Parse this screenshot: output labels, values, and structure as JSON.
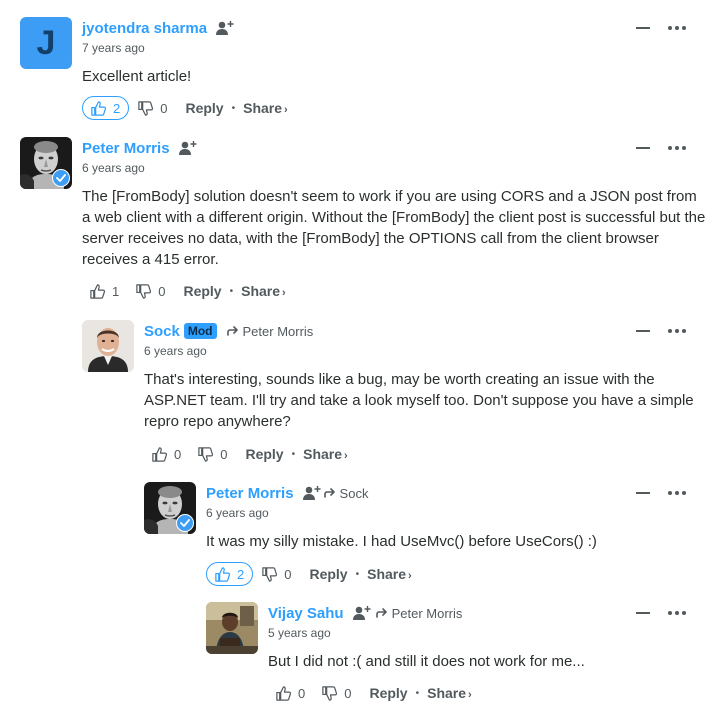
{
  "comments": [
    {
      "author": "jyotendra sharma",
      "avatar_letter": "J",
      "time": "7 years ago",
      "body": "Excellent article!",
      "upvotes": "2",
      "downvotes": "0",
      "upvoted": true,
      "reply_to": null
    },
    {
      "author": "Peter Morris",
      "time": "6 years ago",
      "body": "The [FromBody] solution doesn't seem to work if you are using CORS and a JSON post from a web client with a different origin. Without the [FromBody] the client post is successful but the server receives no data, with the [FromBody] the OPTIONS call from the client browser receives a 415 error.",
      "upvotes": "1",
      "downvotes": "0",
      "upvoted": false,
      "reply_to": null
    },
    {
      "author": "Sock",
      "badge": "Mod",
      "reply_to": "Peter Morris",
      "time": "6 years ago",
      "body": "That's interesting, sounds like a bug, may be worth creating an issue with the ASP.NET team. I'll try and take a look myself too. Don't suppose you have a simple repro repo anywhere?",
      "upvotes": "0",
      "downvotes": "0",
      "upvoted": false
    },
    {
      "author": "Peter Morris",
      "reply_to": "Sock",
      "time": "6 years ago",
      "body": "It was my silly mistake. I had UseMvc() before UseCors() :)",
      "upvotes": "2",
      "downvotes": "0",
      "upvoted": true
    },
    {
      "author": "Vijay Sahu",
      "reply_to": "Peter Morris",
      "time": "5 years ago",
      "body": "But I did not :( and still it does not work for me...",
      "upvotes": "0",
      "downvotes": "0",
      "upvoted": false
    }
  ],
  "labels": {
    "reply": "Reply",
    "share": "Share",
    "share_chevron": "›",
    "dot": "•"
  },
  "colors": {
    "accent": "#2e9fff",
    "text": "#2a2e2e",
    "muted": "#525a5e"
  },
  "icons": [
    "follow-icon",
    "reply-arrow-icon",
    "thumbs-up-icon",
    "thumbs-down-icon",
    "collapse-icon",
    "more-options-icon",
    "verified-badge-icon"
  ]
}
